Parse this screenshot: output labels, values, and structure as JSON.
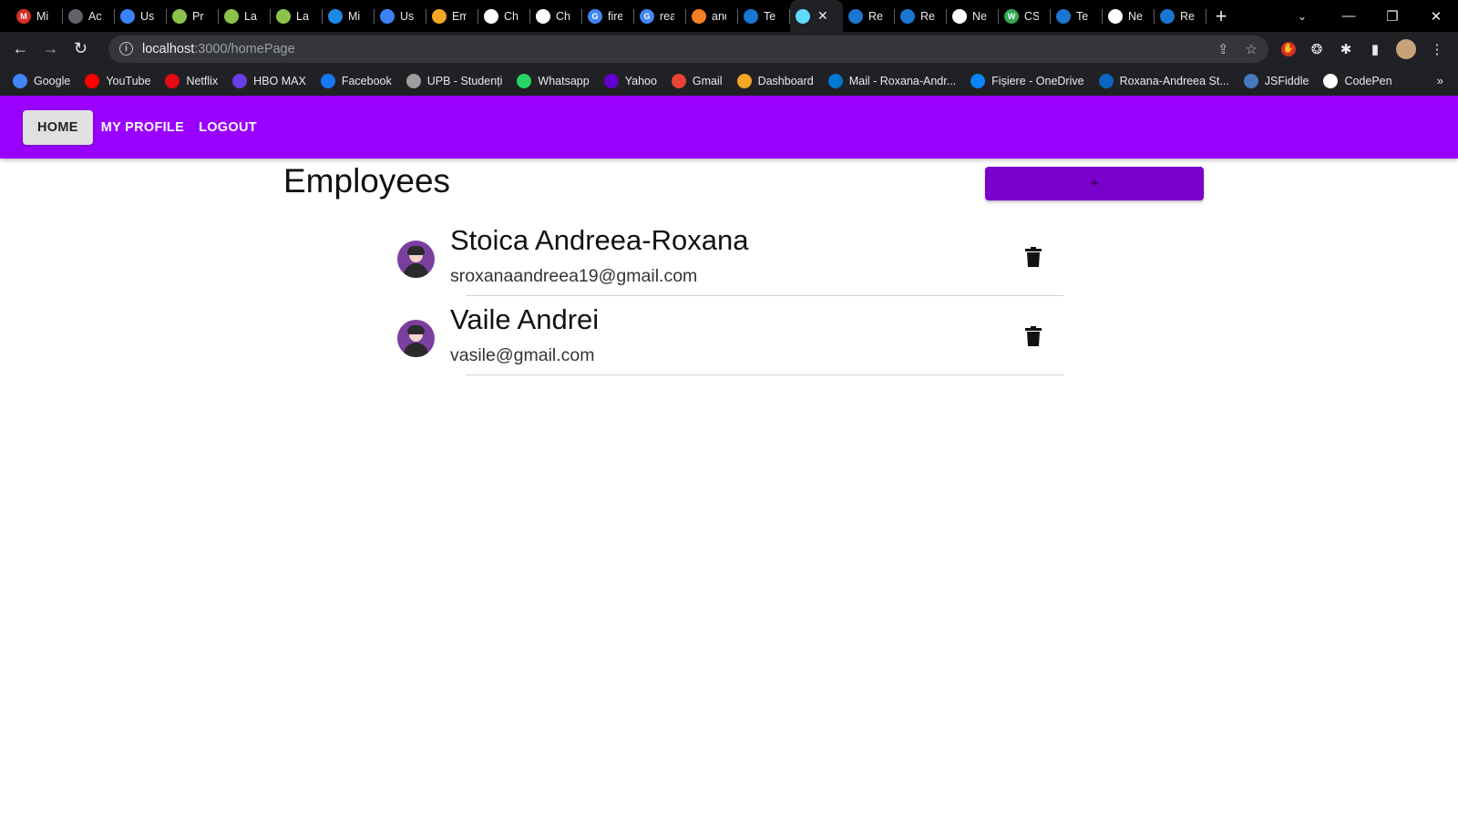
{
  "browser": {
    "tabs": [
      {
        "title": "Mi",
        "fav_color": "#d93025",
        "fav_char": "M"
      },
      {
        "title": "Ac",
        "fav_color": "#5f6368",
        "fav_char": ""
      },
      {
        "title": "Us",
        "fav_color": "#3b82f6",
        "fav_char": ""
      },
      {
        "title": "Pr",
        "fav_color": "#8bc34a",
        "fav_char": ""
      },
      {
        "title": "La",
        "fav_color": "#8bc34a",
        "fav_char": ""
      },
      {
        "title": "La",
        "fav_color": "#8bc34a",
        "fav_char": ""
      },
      {
        "title": "Mi",
        "fav_color": "#1e88e5",
        "fav_char": ""
      },
      {
        "title": "Us",
        "fav_color": "#3b82f6",
        "fav_char": ""
      },
      {
        "title": "Em",
        "fav_color": "#f5a623",
        "fav_char": ""
      },
      {
        "title": "Ch",
        "fav_color": "#ffffff",
        "fav_char": ""
      },
      {
        "title": "Ch",
        "fav_color": "#ffffff",
        "fav_char": ""
      },
      {
        "title": "fire",
        "fav_color": "#4285f4",
        "fav_char": "G"
      },
      {
        "title": "rea",
        "fav_color": "#4285f4",
        "fav_char": "G"
      },
      {
        "title": "and",
        "fav_color": "#f48024",
        "fav_char": ""
      },
      {
        "title": "Te",
        "fav_color": "#1976d2",
        "fav_char": ""
      },
      {
        "title": "",
        "fav_color": "#61dafb",
        "fav_char": "",
        "active": true
      },
      {
        "title": "Re",
        "fav_color": "#1976d2",
        "fav_char": ""
      },
      {
        "title": "Re",
        "fav_color": "#1976d2",
        "fav_char": ""
      },
      {
        "title": "Ne",
        "fav_color": "#ffffff",
        "fav_char": ""
      },
      {
        "title": "CS",
        "fav_color": "#34a853",
        "fav_char": "W"
      },
      {
        "title": "Te",
        "fav_color": "#1976d2",
        "fav_char": ""
      },
      {
        "title": "Ne",
        "fav_color": "#ffffff",
        "fav_char": ""
      },
      {
        "title": "Re",
        "fav_color": "#1976d2",
        "fav_char": ""
      }
    ],
    "url_host": "localhost",
    "url_path": ":3000/homePage",
    "bookmarks": [
      {
        "label": "Google",
        "fav_color": "#4285f4"
      },
      {
        "label": "YouTube",
        "fav_color": "#ff0000"
      },
      {
        "label": "Netflix",
        "fav_color": "#e50914"
      },
      {
        "label": "HBO MAX",
        "fav_color": "#6a3de8"
      },
      {
        "label": "Facebook",
        "fav_color": "#1877f2"
      },
      {
        "label": "UPB - Studenți",
        "fav_color": "#9e9e9e"
      },
      {
        "label": "Whatsapp",
        "fav_color": "#25d366"
      },
      {
        "label": "Yahoo",
        "fav_color": "#6001d2"
      },
      {
        "label": "Gmail",
        "fav_color": "#ea4335"
      },
      {
        "label": "Dashboard",
        "fav_color": "#f5a623"
      },
      {
        "label": "Mail - Roxana-Andr...",
        "fav_color": "#0078d4"
      },
      {
        "label": "Fișiere - OneDrive",
        "fav_color": "#0a84ff"
      },
      {
        "label": "Roxana-Andreea St...",
        "fav_color": "#0a66c2"
      },
      {
        "label": "JSFiddle",
        "fav_color": "#4679bd"
      },
      {
        "label": "CodePen",
        "fav_color": "#ffffff"
      }
    ],
    "bookmarks_more": "»"
  },
  "app": {
    "accent": "#9a00ff",
    "nav": {
      "home": "HOME",
      "profile": "MY PROFILE",
      "logout": "LOGOUT"
    },
    "page_title": "Employees",
    "add_button_label": "+",
    "employees": [
      {
        "name": "Stoica Andreea-Roxana",
        "email": "sroxanaandreea19@gmail.com",
        "avatar": "avatar-female-icon"
      },
      {
        "name": "Vaile Andrei",
        "email": "vasile@gmail.com",
        "avatar": "avatar-male-icon"
      }
    ]
  }
}
